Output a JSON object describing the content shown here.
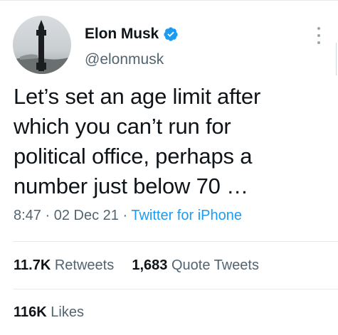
{
  "author": {
    "name": "Elon Musk",
    "handle": "@elonmusk",
    "verified_icon": "verified-badge-icon",
    "verified_color": "#1d9bf0"
  },
  "tweet": {
    "lines": [
      "Let’s set an age limit after",
      "which you can’t run for",
      "political office, perhaps a",
      "number just below 70 …"
    ]
  },
  "meta": {
    "time": "8:47",
    "date": "02 Dec 21",
    "separator": "·",
    "source": "Twitter for iPhone"
  },
  "stats": {
    "retweets_count": "11.7K",
    "retweets_label": "Retweets",
    "quotes_count": "1,683",
    "quotes_label": "Quote Tweets",
    "likes_count": "116K",
    "likes_label": "Likes"
  },
  "colors": {
    "text": "#0f1419",
    "muted": "#536471",
    "link": "#1d9bf0",
    "divider": "#e7e9ea"
  }
}
